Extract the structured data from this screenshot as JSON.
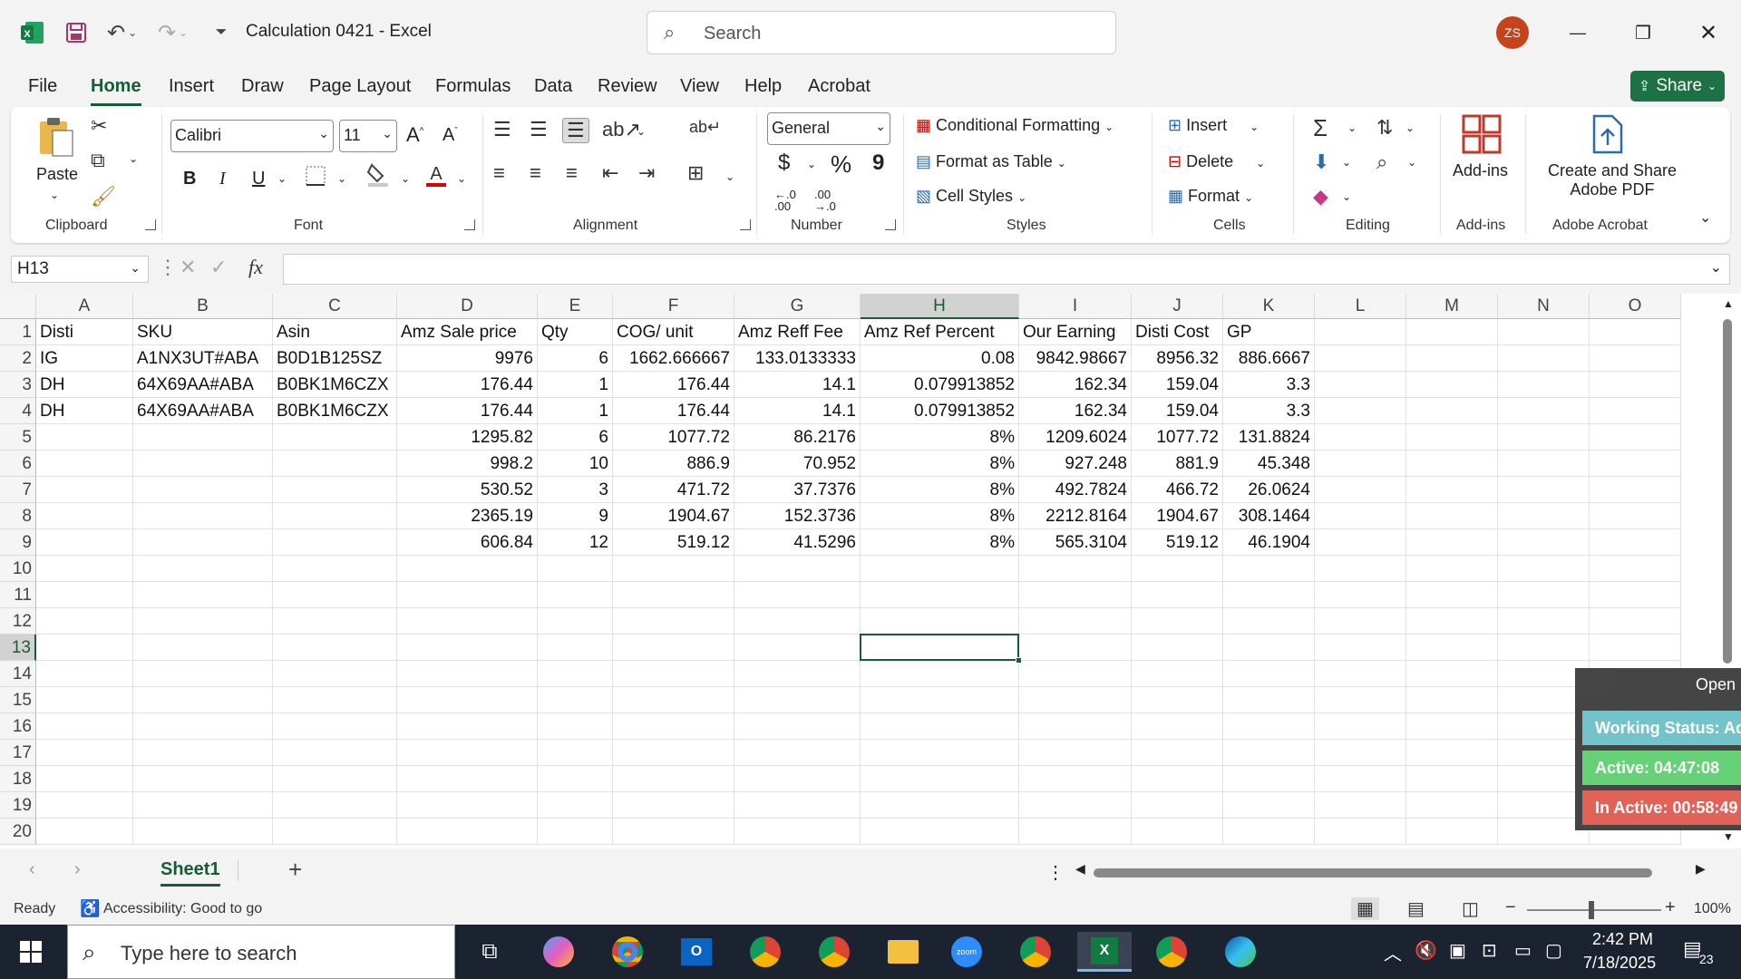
{
  "window": {
    "app_icon": "excel-icon",
    "title": "Calculation 0421  -  Excel",
    "search_placeholder": "Search",
    "avatar_initials": "ZS",
    "minimize": "—",
    "restore": "❐",
    "close": "✕"
  },
  "tabs": [
    "File",
    "Home",
    "Insert",
    "Draw",
    "Page Layout",
    "Formulas",
    "Data",
    "Review",
    "View",
    "Help",
    "Acrobat"
  ],
  "active_tab": "Home",
  "share_label": "Share",
  "ribbon": {
    "clipboard": {
      "paste": "Paste",
      "label": "Clipboard"
    },
    "font": {
      "name": "Calibri",
      "size": "11",
      "label": "Font",
      "bold": "B",
      "italic": "I",
      "underline": "U",
      "grow": "A",
      "shrink": "A"
    },
    "alignment": {
      "label": "Alignment"
    },
    "number": {
      "format": "General",
      "label": "Number",
      "currency": "$",
      "percent": "%",
      "comma": "9",
      "inc_dec": "←.0 .00",
      "dec_dec": ".00 →.0"
    },
    "styles": {
      "conditional": "Conditional Formatting",
      "format_table": "Format as Table",
      "cell_styles": "Cell Styles",
      "label": "Styles"
    },
    "cells": {
      "insert": "Insert",
      "delete": "Delete",
      "format": "Format",
      "label": "Cells"
    },
    "editing": {
      "label": "Editing"
    },
    "addins": {
      "button": "Add-ins",
      "label": "Add-ins"
    },
    "acrobat": {
      "button_line1": "Create and Share",
      "button_line2": "Adobe PDF",
      "label": "Adobe Acrobat"
    }
  },
  "formula_bar": {
    "name_box": "H13",
    "fx": "fx",
    "value": ""
  },
  "columns": [
    "A",
    "B",
    "C",
    "D",
    "E",
    "F",
    "G",
    "H",
    "I",
    "J",
    "K",
    "L",
    "M",
    "N",
    "O"
  ],
  "selected_column": "H",
  "rows": [
    "1",
    "2",
    "3",
    "4",
    "5",
    "6",
    "7",
    "8",
    "9",
    "10",
    "11",
    "12",
    "13",
    "14",
    "15",
    "16",
    "17",
    "18",
    "19",
    "20"
  ],
  "selected_row": "13",
  "cells": [
    [
      "Disti",
      "SKU",
      "Asin",
      "Amz Sale price",
      "Qty",
      "COG/ unit",
      "Amz Reff Fee",
      "Amz Ref Percent",
      "Our Earning",
      "Disti Cost",
      "GP"
    ],
    [
      "IG",
      "A1NX3UT#ABA",
      "B0D1B125SZ",
      "9976",
      "6",
      "1662.666667",
      "133.0133333",
      "0.08",
      "9842.98667",
      "8956.32",
      "886.6667"
    ],
    [
      "DH",
      "64X69AA#ABA",
      "B0BK1M6CZX",
      "176.44",
      "1",
      "176.44",
      "14.1",
      "0.079913852",
      "162.34",
      "159.04",
      "3.3"
    ],
    [
      "DH",
      "64X69AA#ABA",
      "B0BK1M6CZX",
      "176.44",
      "1",
      "176.44",
      "14.1",
      "0.079913852",
      "162.34",
      "159.04",
      "3.3"
    ],
    [
      "",
      "",
      "",
      "1295.82",
      "6",
      "1077.72",
      "86.2176",
      "8%",
      "1209.6024",
      "1077.72",
      "131.8824"
    ],
    [
      "",
      "",
      "",
      "998.2",
      "10",
      "886.9",
      "70.952",
      "8%",
      "927.248",
      "881.9",
      "45.348"
    ],
    [
      "",
      "",
      "",
      "530.52",
      "3",
      "471.72",
      "37.7376",
      "8%",
      "492.7824",
      "466.72",
      "26.0624"
    ],
    [
      "",
      "",
      "",
      "2365.19",
      "9",
      "1904.67",
      "152.3736",
      "8%",
      "2212.8164",
      "1904.67",
      "308.1464"
    ],
    [
      "",
      "",
      "",
      "606.84",
      "12",
      "519.12",
      "41.5296",
      "8%",
      "565.3104",
      "519.12",
      "46.1904"
    ]
  ],
  "widget": {
    "header": "Open",
    "status": "Working Status: Ac",
    "active": "Active: 04:47:08",
    "inactive": "In Active: 00:58:49"
  },
  "sheet_tabs": [
    "Sheet1"
  ],
  "status": {
    "ready": "Ready",
    "accessibility": "Accessibility: Good to go",
    "zoom": "100%"
  },
  "taskbar": {
    "search_placeholder": "Type here to search",
    "time": "2:42 PM",
    "date": "7/18/2025",
    "notif": "23"
  }
}
